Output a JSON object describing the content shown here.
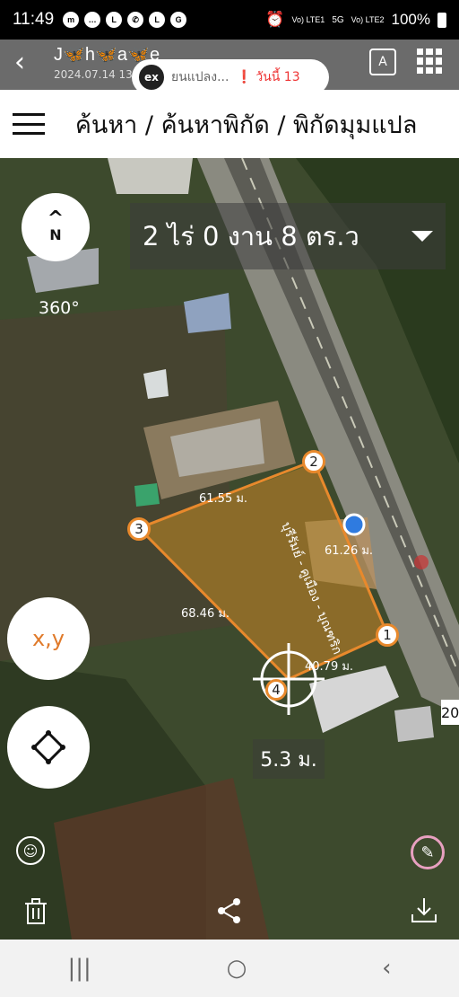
{
  "status_bar": {
    "time": "11:49",
    "battery": "100%",
    "network_1": "Vo) LTE1",
    "network_2": "Vo) LTE2",
    "signal_label": "5G"
  },
  "header": {
    "title": "J🦋h🦋a🦋e",
    "date": "2024.07.14 13",
    "ex_label": "ex",
    "notice_text": "ยนแปลง...",
    "today_text": "❗ วันนี้ 13",
    "scan_label": "A"
  },
  "breadcrumb": {
    "text": "ค้นหา / ค้นหาพิกัด / พิกัดมุมแปล"
  },
  "map": {
    "compass_label": "N",
    "rotation": "360°",
    "area_text": "2 ไร่ 0 งาน 8 ตร.ว",
    "road_name": "บุรีรัมย์ - คูเมือง - บุณฑริก",
    "edge_labels": [
      "61.55 ม.",
      "61.26 ม.",
      "68.46 ม.",
      "40.79 ม."
    ],
    "corner_labels": [
      "1",
      "2",
      "3",
      "4"
    ],
    "distance": "5.3 ม.",
    "xy_label": "x,y",
    "side_badge": "20"
  },
  "colors": {
    "accent": "#e8892c",
    "header_bg": "#6b6b6b",
    "location_dot": "#2f7be0"
  },
  "icons": {
    "delete": "trash-icon",
    "share": "share-icon",
    "download": "download-icon"
  },
  "nav_bar": {
    "recent": "|||",
    "home": "○",
    "back": "‹"
  }
}
